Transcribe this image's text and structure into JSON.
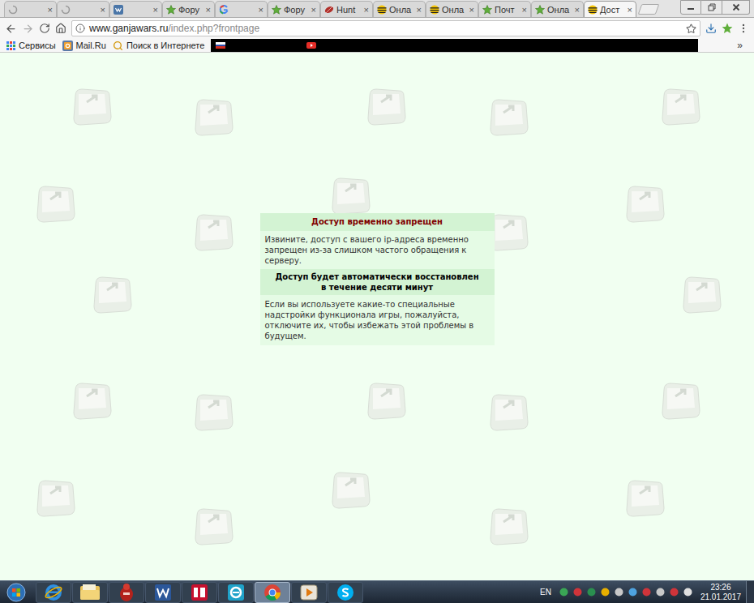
{
  "browser": {
    "tabs": [
      {
        "label": "",
        "kind": "loading",
        "selected": false
      },
      {
        "label": "",
        "kind": "loading",
        "selected": false
      },
      {
        "label": "",
        "kind": "vk",
        "selected": false
      },
      {
        "label": "Фору",
        "kind": "star",
        "selected": false
      },
      {
        "label": "",
        "kind": "google",
        "selected": false
      },
      {
        "label": "Фору",
        "kind": "star",
        "selected": false
      },
      {
        "label": "Hunt",
        "kind": "hunt",
        "selected": false
      },
      {
        "label": "Онла",
        "kind": "beeline",
        "selected": false
      },
      {
        "label": "Онла",
        "kind": "beeline",
        "selected": false
      },
      {
        "label": "Почт",
        "kind": "star",
        "selected": false
      },
      {
        "label": "Онла",
        "kind": "star",
        "selected": false
      },
      {
        "label": "Дост",
        "kind": "beeline",
        "selected": true
      }
    ],
    "tab_close": "×",
    "address": {
      "host": "www.ganjawars.ru",
      "path": "/index.php?frontpage"
    },
    "bookmarks": [
      {
        "label": "Сервисы",
        "kind": "apps"
      },
      {
        "label": "Mail.Ru",
        "kind": "mail"
      },
      {
        "label": "Поиск в Интернете",
        "kind": "search"
      }
    ],
    "bookmarks_overflow": "»"
  },
  "notice": {
    "title": "Доступ временно запрещен",
    "message": "Извините, доступ с вашего ip-адреса временно запрещен из-за слишком частого обращения к серверу.",
    "restore": [
      "Доступ будет автоматически восстановлен",
      "в течение десяти минут"
    ],
    "advice": "Если вы используете какие-то специальные надстройки функционала игры, пожалуйста, отключите их, чтобы избежать этой проблемы в будущем."
  },
  "taskbar": {
    "apps": [
      {
        "kind": "ie",
        "active": false
      },
      {
        "kind": "explorer",
        "active": false
      },
      {
        "kind": "red",
        "active": false
      },
      {
        "kind": "word",
        "active": false
      },
      {
        "kind": "sixtyfour",
        "active": false
      },
      {
        "kind": "edge",
        "active": false
      },
      {
        "kind": "chrome",
        "active": true
      },
      {
        "kind": "player",
        "active": false
      },
      {
        "kind": "skype",
        "active": false
      }
    ],
    "language": "EN",
    "time": "23:26",
    "date": "21.01.2017"
  }
}
